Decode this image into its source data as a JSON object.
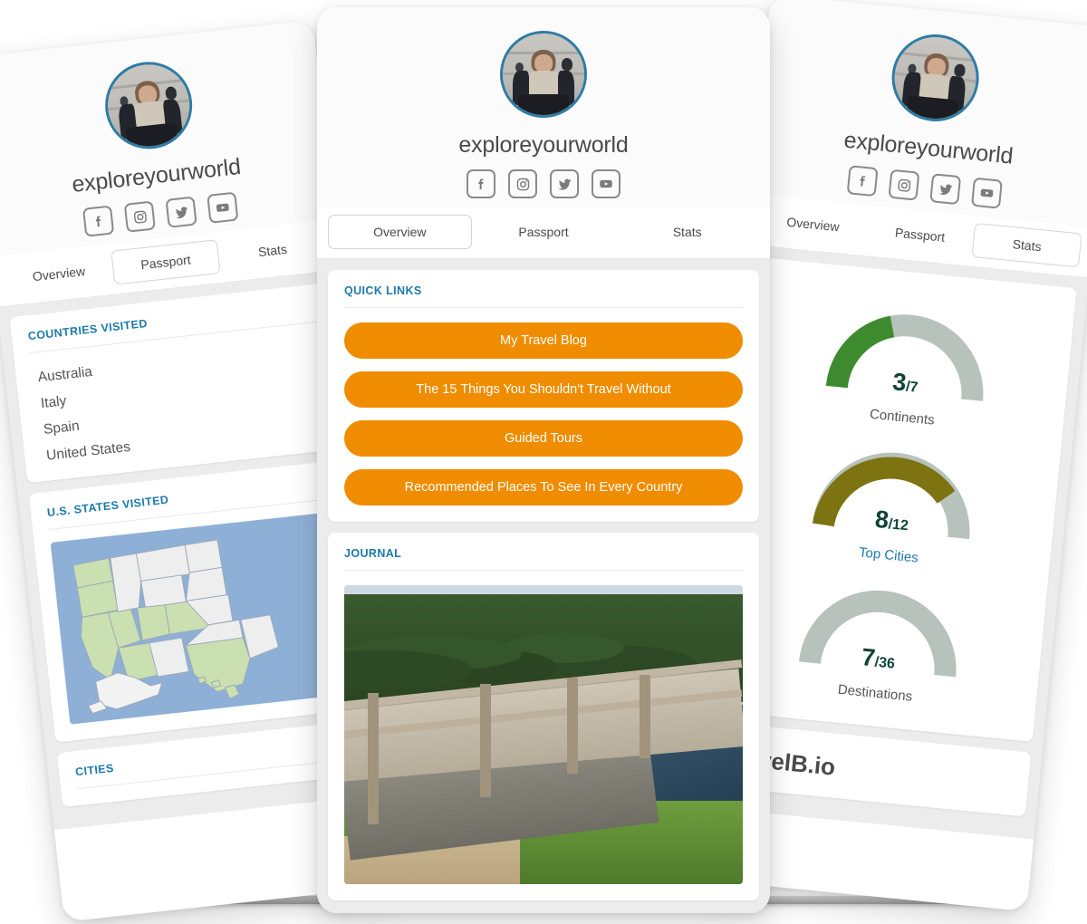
{
  "profile": {
    "handle": "exploreyourworld",
    "avatar_alt": "profile-photo",
    "socials": [
      {
        "name": "facebook-icon",
        "label": "Facebook"
      },
      {
        "name": "instagram-icon",
        "label": "Instagram"
      },
      {
        "name": "twitter-icon",
        "label": "Twitter"
      },
      {
        "name": "youtube-icon",
        "label": "YouTube"
      }
    ]
  },
  "tabs": {
    "overview": "Overview",
    "passport": "Passport",
    "stats": "Stats"
  },
  "center_card": {
    "active_tab": "Overview",
    "quick_links": {
      "title": "QUICK LINKS",
      "links": [
        "My Travel Blog",
        "The 15 Things You Shouldn't Travel Without",
        "Guided Tours",
        "Recommended Places To See In Every Country"
      ]
    },
    "journal": {
      "title": "JOURNAL",
      "photo_caption": "Old North Bridge wooden footbridge over river"
    }
  },
  "left_card": {
    "active_tab": "Passport",
    "countries": {
      "title": "COUNTRIES VISITED",
      "items": [
        "Australia",
        "Italy",
        "Spain",
        "United States"
      ]
    },
    "states": {
      "title": "U.S. STATES VISITED",
      "visited": [
        "Washington",
        "Oregon",
        "California",
        "Nevada",
        "Utah",
        "Arizona",
        "Colorado",
        "Texas",
        "Hawaii"
      ]
    },
    "cities": {
      "title": "CITIES"
    }
  },
  "right_card": {
    "active_tab": "Stats",
    "gauges": [
      {
        "name": "continents",
        "value": "3",
        "denominator": "/7",
        "label": "Continents",
        "color": "#3d8b2e",
        "link": false
      },
      {
        "name": "top-cities",
        "value": "8",
        "denominator": "/12",
        "label": "Top Cities",
        "color": "#7d7310",
        "link": true
      },
      {
        "name": "destinations",
        "value": "7",
        "denominator": "/36",
        "label": "Destinations",
        "color": "#b7c2bd",
        "link": false
      }
    ],
    "brand": "TravelB.io"
  },
  "colors": {
    "accent_blue": "#1b79ab",
    "orange": "#f08c00",
    "gauge_track": "#b7c2bd",
    "gauge_green": "#3d8b2e",
    "gauge_olive": "#7d7310",
    "panel_bg": "#ececec",
    "map_water": "#8fb0d6",
    "map_visited": "#cbe0b0",
    "map_unvisited": "#eeeeee"
  },
  "chart_data": [
    {
      "type": "pie",
      "title": "Continents",
      "value": 3,
      "max": 7,
      "fraction": 0.4286,
      "value_label": "3",
      "max_label": "/7",
      "color": "#3d8b2e",
      "track_color": "#b7c2bd"
    },
    {
      "type": "pie",
      "title": "Top Cities",
      "value": 8,
      "max": 12,
      "fraction": 0.6667,
      "value_label": "8",
      "max_label": "/12",
      "color": "#7d7310",
      "track_color": "#b7c2bd"
    },
    {
      "type": "pie",
      "title": "Destinations",
      "value": 7,
      "max": 36,
      "fraction": 0.1944,
      "value_label": "7",
      "max_label": "/36",
      "color": "#b7c2bd",
      "track_color": "#b7c2bd"
    }
  ]
}
